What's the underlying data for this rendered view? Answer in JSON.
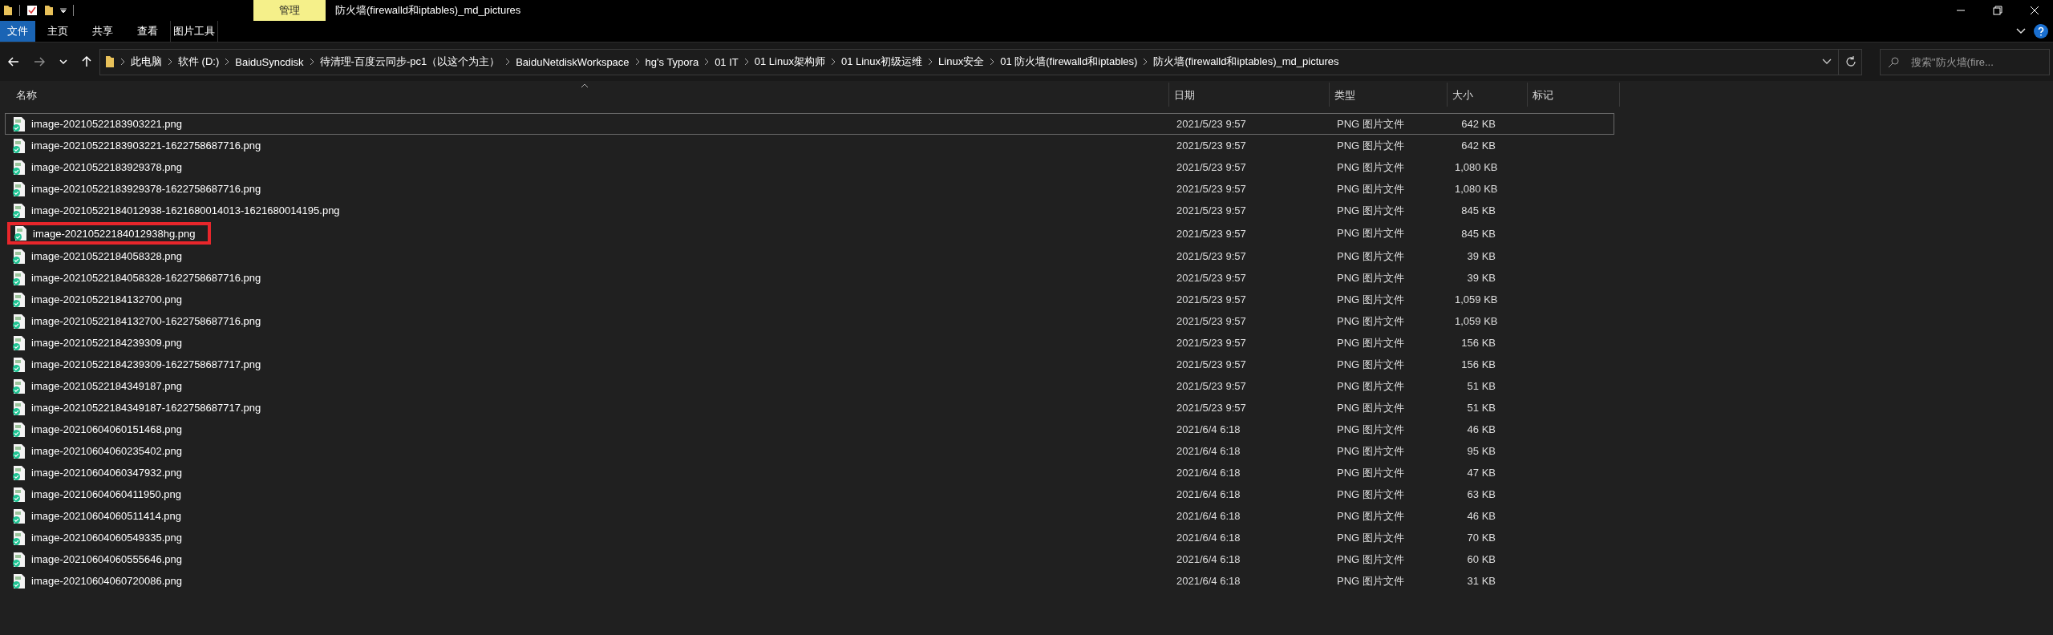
{
  "window": {
    "title": "防火墙(firewalld和iptables)_md_pictures"
  },
  "ribbon": {
    "context_group": "管理",
    "tabs": [
      {
        "label": "文件",
        "kind": "file"
      },
      {
        "label": "主页",
        "kind": "tab"
      },
      {
        "label": "共享",
        "kind": "tab"
      },
      {
        "label": "查看",
        "kind": "tab"
      },
      {
        "label": "图片工具",
        "kind": "context"
      }
    ]
  },
  "address_bar": {
    "breadcrumbs": [
      "此电脑",
      "软件 (D:)",
      "BaiduSyncdisk",
      "待清理-百度云同步-pc1（以这个为主）",
      "BaiduNetdiskWorkspace",
      "hg's Typora",
      "01 IT",
      "01 Linux架构师",
      "01 Linux初级运维",
      "Linux安全",
      "01 防火墙(firewalld和iptables)",
      "防火墙(firewalld和iptables)_md_pictures"
    ]
  },
  "search": {
    "placeholder": "搜索\"防火墙(fire..."
  },
  "table": {
    "columns": [
      {
        "label": "名称",
        "sorted": true
      },
      {
        "label": "日期",
        "sorted": false
      },
      {
        "label": "类型",
        "sorted": false
      },
      {
        "label": "大小",
        "sorted": false
      },
      {
        "label": "标记",
        "sorted": false
      }
    ],
    "rows": [
      {
        "name": "image-20210522183903221.png",
        "date": "2021/5/23 9:57",
        "type": "PNG 图片文件",
        "size": "642 KB",
        "focused": true,
        "highlighted": false
      },
      {
        "name": "image-20210522183903221-1622758687716.png",
        "date": "2021/5/23 9:57",
        "type": "PNG 图片文件",
        "size": "642 KB",
        "focused": false,
        "highlighted": false
      },
      {
        "name": "image-20210522183929378.png",
        "date": "2021/5/23 9:57",
        "type": "PNG 图片文件",
        "size": "1,080 KB",
        "focused": false,
        "highlighted": false
      },
      {
        "name": "image-20210522183929378-1622758687716.png",
        "date": "2021/5/23 9:57",
        "type": "PNG 图片文件",
        "size": "1,080 KB",
        "focused": false,
        "highlighted": false
      },
      {
        "name": "image-20210522184012938-1621680014013-1621680014195.png",
        "date": "2021/5/23 9:57",
        "type": "PNG 图片文件",
        "size": "845 KB",
        "focused": false,
        "highlighted": false
      },
      {
        "name": "image-20210522184012938hg.png",
        "date": "2021/5/23 9:57",
        "type": "PNG 图片文件",
        "size": "845 KB",
        "focused": false,
        "highlighted": true
      },
      {
        "name": "image-20210522184058328.png",
        "date": "2021/5/23 9:57",
        "type": "PNG 图片文件",
        "size": "39 KB",
        "focused": false,
        "highlighted": false
      },
      {
        "name": "image-20210522184058328-1622758687716.png",
        "date": "2021/5/23 9:57",
        "type": "PNG 图片文件",
        "size": "39 KB",
        "focused": false,
        "highlighted": false
      },
      {
        "name": "image-20210522184132700.png",
        "date": "2021/5/23 9:57",
        "type": "PNG 图片文件",
        "size": "1,059 KB",
        "focused": false,
        "highlighted": false
      },
      {
        "name": "image-20210522184132700-1622758687716.png",
        "date": "2021/5/23 9:57",
        "type": "PNG 图片文件",
        "size": "1,059 KB",
        "focused": false,
        "highlighted": false
      },
      {
        "name": "image-20210522184239309.png",
        "date": "2021/5/23 9:57",
        "type": "PNG 图片文件",
        "size": "156 KB",
        "focused": false,
        "highlighted": false
      },
      {
        "name": "image-20210522184239309-1622758687717.png",
        "date": "2021/5/23 9:57",
        "type": "PNG 图片文件",
        "size": "156 KB",
        "focused": false,
        "highlighted": false
      },
      {
        "name": "image-20210522184349187.png",
        "date": "2021/5/23 9:57",
        "type": "PNG 图片文件",
        "size": "51 KB",
        "focused": false,
        "highlighted": false
      },
      {
        "name": "image-20210522184349187-1622758687717.png",
        "date": "2021/5/23 9:57",
        "type": "PNG 图片文件",
        "size": "51 KB",
        "focused": false,
        "highlighted": false
      },
      {
        "name": "image-20210604060151468.png",
        "date": "2021/6/4 6:18",
        "type": "PNG 图片文件",
        "size": "46 KB",
        "focused": false,
        "highlighted": false
      },
      {
        "name": "image-20210604060235402.png",
        "date": "2021/6/4 6:18",
        "type": "PNG 图片文件",
        "size": "95 KB",
        "focused": false,
        "highlighted": false
      },
      {
        "name": "image-20210604060347932.png",
        "date": "2021/6/4 6:18",
        "type": "PNG 图片文件",
        "size": "47 KB",
        "focused": false,
        "highlighted": false
      },
      {
        "name": "image-20210604060411950.png",
        "date": "2021/6/4 6:18",
        "type": "PNG 图片文件",
        "size": "63 KB",
        "focused": false,
        "highlighted": false
      },
      {
        "name": "image-20210604060511414.png",
        "date": "2021/6/4 6:18",
        "type": "PNG 图片文件",
        "size": "46 KB",
        "focused": false,
        "highlighted": false
      },
      {
        "name": "image-20210604060549335.png",
        "date": "2021/6/4 6:18",
        "type": "PNG 图片文件",
        "size": "70 KB",
        "focused": false,
        "highlighted": false
      },
      {
        "name": "image-20210604060555646.png",
        "date": "2021/6/4 6:18",
        "type": "PNG 图片文件",
        "size": "60 KB",
        "focused": false,
        "highlighted": false
      },
      {
        "name": "image-20210604060720086.png",
        "date": "2021/6/4 6:18",
        "type": "PNG 图片文件",
        "size": "31 KB",
        "focused": false,
        "highlighted": false
      }
    ]
  }
}
